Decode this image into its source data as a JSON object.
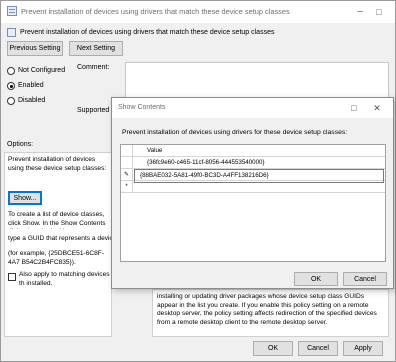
{
  "window": {
    "title": "Prevent installation of devices using drivers that match these device setup classes",
    "setting_title": "Prevent installation of devices using drivers that match these device setup classes"
  },
  "nav": {
    "prev": "Previous Setting",
    "next": "Next Setting"
  },
  "state": {
    "not_configured": "Not Configured",
    "enabled": "Enabled",
    "disabled": "Disabled",
    "selected": "enabled"
  },
  "labels": {
    "comment": "Comment:",
    "supported_on": "Supported on",
    "options": "Options:"
  },
  "options_panel": {
    "desc": "Prevent installation of devices using these device setup classes:",
    "show_button": "Show...",
    "help1": "To create a list of device classes, click Show. In the Show Contents dialog box, in the Va",
    "help2": "type a GUID that represents a device",
    "example": "(for example, {25DBCE51-6C8F-4A7 B54C2B4FC835}).",
    "also_apply": "Also apply to matching devices th installed."
  },
  "help_panel": {
    "text": "installing or updating driver packages whose device setup class GUIDs appear in the list you create. If you enable this policy setting on a remote desktop server, the policy setting affects redirection of the specified devices from a remote desktop client to the remote desktop server."
  },
  "footer": {
    "ok": "OK",
    "cancel": "Cancel",
    "apply": "Apply"
  },
  "dialog": {
    "title": "Show Contents",
    "description": "Prevent installation of devices using drivers for these device setup classes:",
    "column_header": "Value",
    "rows": [
      {
        "marker": "",
        "value": "{36fc9e60-c465-11cf-8056-444553540000}"
      },
      {
        "marker": "✎",
        "value": "{88BAE032-5A81-49f0-BC3D-A4FF138216D6}"
      },
      {
        "marker": "*",
        "value": ""
      }
    ],
    "ok": "OK",
    "cancel": "Cancel"
  }
}
